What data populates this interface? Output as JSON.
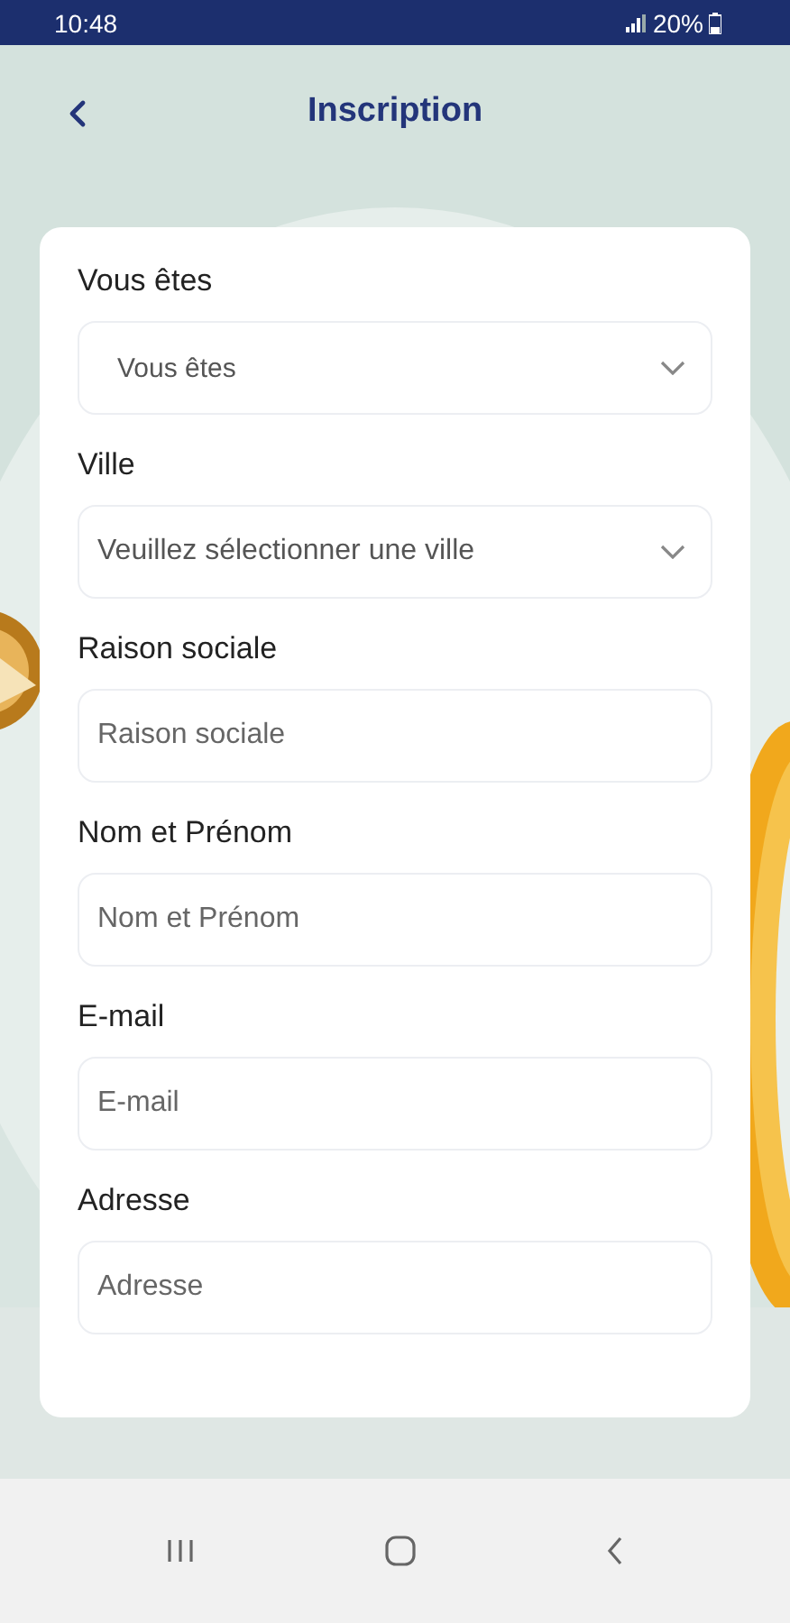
{
  "status_bar": {
    "time": "10:48",
    "battery": "20%"
  },
  "header": {
    "title": "Inscription"
  },
  "form": {
    "fields": [
      {
        "kind": "select",
        "label": "Vous êtes",
        "placeholder": "Vous êtes"
      },
      {
        "kind": "select",
        "label": "Ville",
        "placeholder": "Veuillez sélectionner une ville"
      },
      {
        "kind": "text",
        "label": "Raison sociale",
        "placeholder": "Raison sociale"
      },
      {
        "kind": "text",
        "label": "Nom et Prénom",
        "placeholder": "Nom et Prénom"
      },
      {
        "kind": "text",
        "label": "E-mail",
        "placeholder": "E-mail"
      },
      {
        "kind": "text",
        "label": "Adresse",
        "placeholder": "Adresse"
      }
    ]
  }
}
